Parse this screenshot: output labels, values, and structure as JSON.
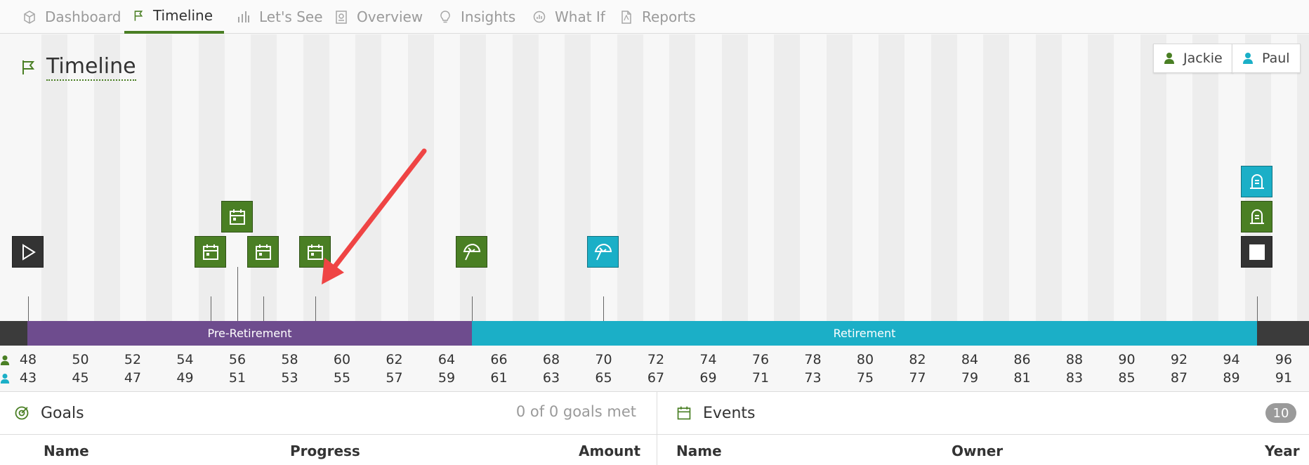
{
  "nav": {
    "tabs": [
      {
        "label": "Dashboard",
        "icon": "package-icon",
        "active": false
      },
      {
        "label": "Timeline",
        "icon": "flag-icon",
        "active": true
      },
      {
        "label": "Let's See",
        "icon": "bar-chart-icon",
        "active": false
      },
      {
        "label": "Overview",
        "icon": "document-chart-icon",
        "active": false
      },
      {
        "label": "Insights",
        "icon": "lightbulb-icon",
        "active": false
      },
      {
        "label": "What If",
        "icon": "gauge-icon",
        "active": false
      },
      {
        "label": "Reports",
        "icon": "pdf-file-icon",
        "active": false
      }
    ]
  },
  "page": {
    "title": "Timeline",
    "title_icon": "flag-icon"
  },
  "people": [
    {
      "name": "Jackie",
      "color": "#4a7f24",
      "icon": "person-icon"
    },
    {
      "name": "Paul",
      "color": "#1bafc7",
      "icon": "person-icon"
    }
  ],
  "phases": [
    {
      "label": "Pre-Retirement",
      "color": "#6e4c8e"
    },
    {
      "label": "Retirement",
      "color": "#1bafc7"
    }
  ],
  "ages": {
    "jackie": [
      "48",
      "50",
      "52",
      "54",
      "56",
      "58",
      "60",
      "62",
      "64",
      "66",
      "68",
      "70",
      "72",
      "74",
      "76",
      "78",
      "80",
      "82",
      "84",
      "86",
      "88",
      "90",
      "92",
      "94",
      "96"
    ],
    "paul": [
      "43",
      "45",
      "47",
      "49",
      "51",
      "53",
      "55",
      "57",
      "59",
      "61",
      "63",
      "65",
      "67",
      "69",
      "71",
      "73",
      "75",
      "77",
      "79",
      "81",
      "83",
      "85",
      "87",
      "89",
      "91"
    ]
  },
  "markers": [
    {
      "kind": "start",
      "icon": "play-icon",
      "color": "#333333"
    },
    {
      "kind": "event",
      "icon": "calendar-icon",
      "color": "#4a7f24"
    },
    {
      "kind": "event",
      "icon": "calendar-icon",
      "color": "#4a7f24"
    },
    {
      "kind": "event",
      "icon": "calendar-icon",
      "color": "#4a7f24"
    },
    {
      "kind": "event",
      "icon": "calendar-icon",
      "color": "#4a7f24"
    },
    {
      "kind": "retirement",
      "icon": "umbrella-icon",
      "color": "#4a7f24"
    },
    {
      "kind": "retirement",
      "icon": "umbrella-icon",
      "color": "#1bafc7"
    },
    {
      "kind": "end",
      "icon": "stop-icon",
      "color": "#333333"
    },
    {
      "kind": "death",
      "icon": "tombstone-icon",
      "color": "#4a7f24"
    },
    {
      "kind": "death",
      "icon": "tombstone-icon",
      "color": "#1bafc7"
    }
  ],
  "goals": {
    "title": "Goals",
    "icon": "target-icon",
    "summary": "0 of 0 goals met",
    "columns": [
      "Name",
      "Progress",
      "Amount"
    ]
  },
  "events": {
    "title": "Events",
    "icon": "calendar-icon",
    "count": "10",
    "columns": [
      "Name",
      "Owner",
      "Year"
    ]
  },
  "colors": {
    "accent": "#4a7f24",
    "teal": "#1bafc7",
    "purple": "#6e4c8e",
    "arrow": "#ef4444"
  }
}
